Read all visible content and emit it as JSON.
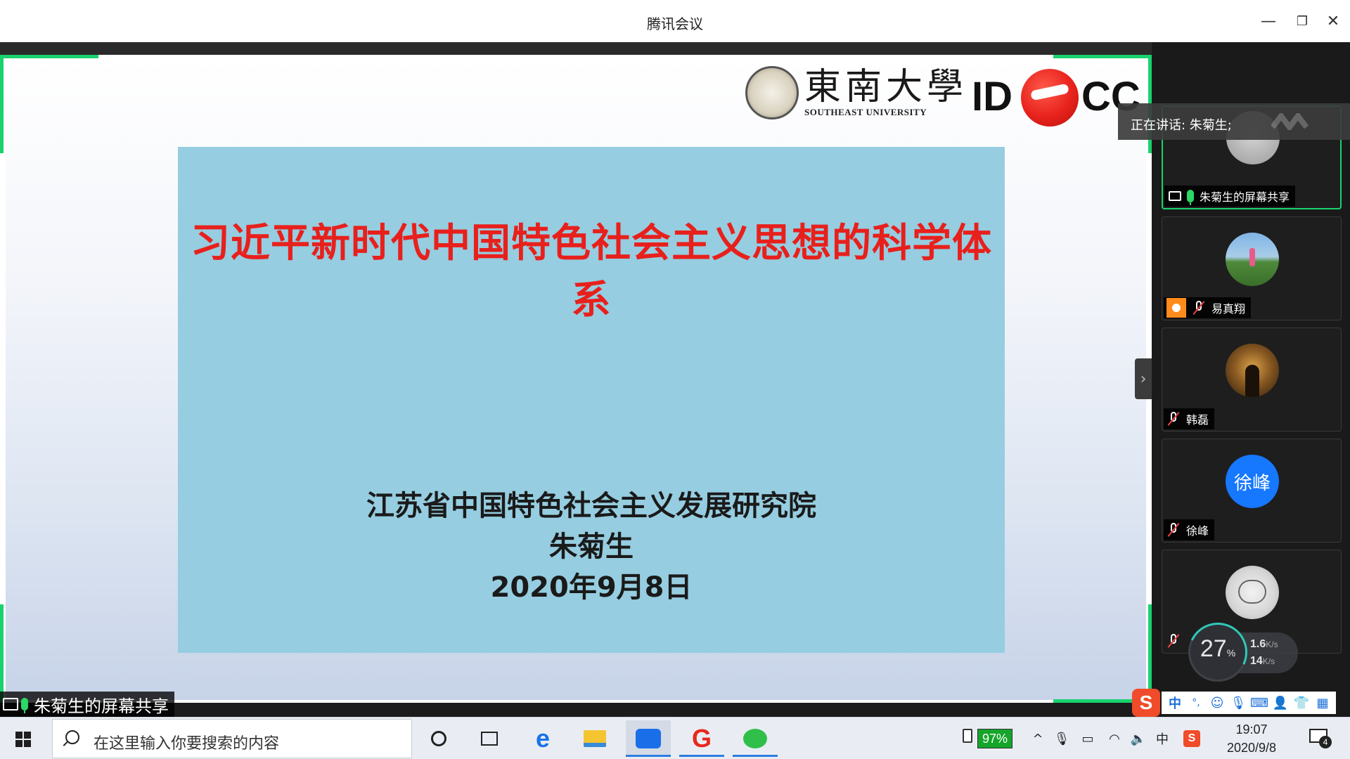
{
  "window": {
    "title": "腾讯会议",
    "minimize_glyph": "—",
    "maximize_glyph": "❐",
    "close_glyph": "✕"
  },
  "slide": {
    "title": "习近平新时代中国特色社会主义思想的科学体系",
    "organization": "江苏省中国特色社会主义发展研究院",
    "author": "朱菊生",
    "date": "2020年9月8日",
    "logo_university_cn": "東南大學",
    "logo_university_en": "SOUTHEAST UNIVERSITY",
    "logo_idcc_left": "ID",
    "logo_idcc_right": "CC",
    "title_color": "#e8201c",
    "panel_color": "#96cde0"
  },
  "share_label": "朱菊生的屏幕共享",
  "speaking_indicator": "正在讲话: 朱菊生;",
  "participants": [
    {
      "name": "朱菊生的屏幕共享",
      "avatar": "gray-default",
      "muted": false,
      "active": true
    },
    {
      "name": "易真翔",
      "avatar": "photo-outdoor",
      "muted": true,
      "active": false
    },
    {
      "name": "韩磊",
      "avatar": "photo-night",
      "muted": true,
      "active": false
    },
    {
      "name": "徐峰",
      "avatar": "text",
      "avatar_text": "徐峰",
      "avatar_color": "#1677ff",
      "muted": true,
      "active": false
    },
    {
      "name": "",
      "avatar": "cartoon-hippo",
      "muted": true,
      "active": false
    }
  ],
  "network": {
    "cpu_percent": "27",
    "cpu_unit": "%",
    "upload": "1.6",
    "upload_unit": "K/s",
    "download": "14",
    "download_unit": "K/s"
  },
  "ime": {
    "logo": "S",
    "mode": "中",
    "punct": "°,",
    "icons": [
      "emoji-icon",
      "mic-icon",
      "keyboard-icon",
      "user-icon",
      "shirt-icon",
      "grid-icon"
    ]
  },
  "taskbar": {
    "search_placeholder": "在这里输入你要搜索的内容",
    "apps": [
      "cortana-icon",
      "task-view-icon",
      "edge-icon",
      "file-explorer-icon",
      "tencent-meeting-icon",
      "browser-g-icon",
      "wechat-icon"
    ],
    "battery_percent": "97%",
    "lang_indicator": "中",
    "time": "19:07",
    "date": "2020/9/8",
    "notification_count": "4"
  }
}
